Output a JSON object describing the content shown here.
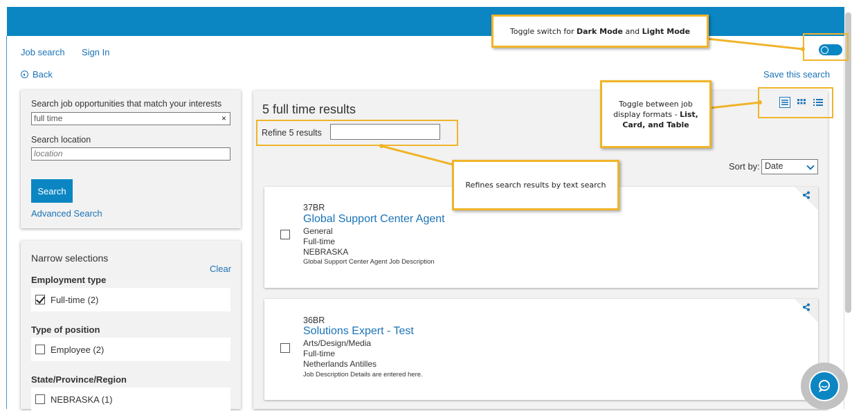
{
  "nav": {
    "job_search": "Job search",
    "sign_in": "Sign In",
    "back": "Back",
    "save_search": "Save this search"
  },
  "search": {
    "keyword_label": "Search job opportunities that match your interests",
    "keyword_value": "full time",
    "clear_symbol": "×",
    "location_label": "Search location",
    "location_placeholder": "location",
    "search_button": "Search",
    "advanced_link": "Advanced Search"
  },
  "filters": {
    "title": "Narrow selections",
    "clear": "Clear",
    "groups": [
      {
        "heading": "Employment type",
        "option": "Full-time (2)",
        "checked": true
      },
      {
        "heading": "Type of position",
        "option": "Employee (2)",
        "checked": false
      },
      {
        "heading": "State/Province/Region",
        "option": "NEBRASKA (1)",
        "checked": false
      }
    ]
  },
  "results": {
    "title": "5 full time results",
    "refine_label": "Refine 5 results",
    "sort_label": "Sort by:",
    "sort_value": "Date",
    "view_icons": [
      "list-view-icon",
      "card-view-icon",
      "table-view-icon"
    ],
    "jobs": [
      {
        "code": "37BR",
        "title": "Global Support Center Agent",
        "category": "General",
        "type": "Full-time",
        "location": "NEBRASKA",
        "description": "Global Support Center Agent Job Description"
      },
      {
        "code": "36BR",
        "title": "Solutions Expert - Test",
        "category": "Arts/Design/Media",
        "type": "Full-time",
        "location": "Netherlands Antilles",
        "description": "Job Description Details are entered here."
      }
    ]
  },
  "callouts": {
    "theme_pre": "Toggle switch for ",
    "theme_dark": "Dark Mode",
    "theme_and": " and ",
    "theme_light": "Light Mode",
    "view_text": "Toggle between job display formats - ",
    "view_bold": "List, Card, and Table",
    "refine_text": "Refines search results by text search"
  },
  "colors": {
    "brand": "#0b86c3",
    "link": "#1a73b7",
    "callout_border": "#f0b429"
  }
}
